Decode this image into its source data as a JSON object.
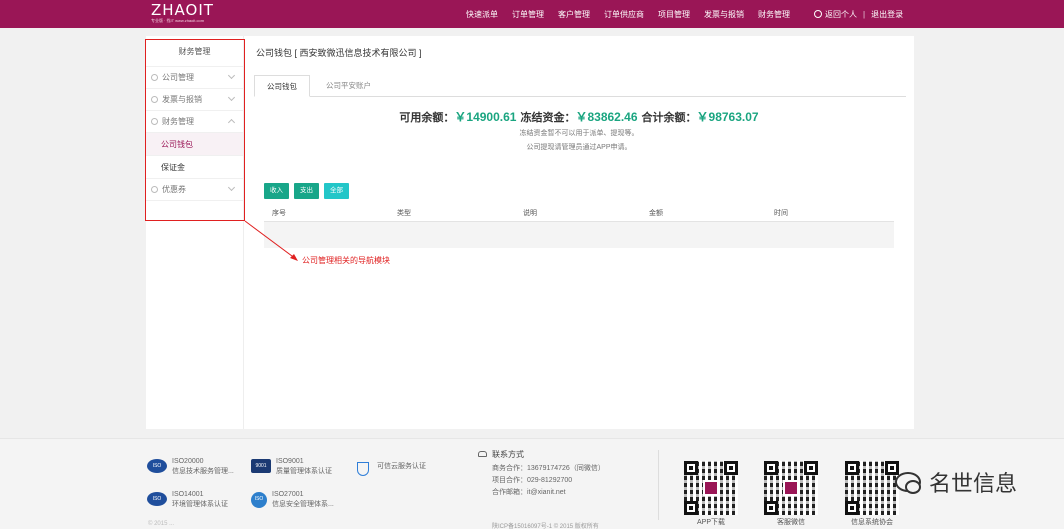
{
  "header": {
    "logo": "ZHAOIT",
    "logo_tag": "专业版 · 找IT  www.zhaoit.com",
    "nav": [
      "快速派单",
      "订单管理",
      "客户管理",
      "订单供应商",
      "项目管理",
      "发票与报销",
      "财务管理"
    ],
    "user_label": "返回个人",
    "separator": "|",
    "logout": "退出登录"
  },
  "sidebar": {
    "title": "财务管理",
    "items": [
      {
        "label": "公司管理",
        "expanded": false
      },
      {
        "label": "发票与报销",
        "expanded": false
      },
      {
        "label": "财务管理",
        "expanded": true
      },
      {
        "label": "公司钱包",
        "sub": true,
        "active": true
      },
      {
        "label": "保证金",
        "sub": true
      },
      {
        "label": "优惠券",
        "expanded": false
      }
    ]
  },
  "main": {
    "title": "公司钱包 [ 西安致微迅信息技术有限公司 ]",
    "tabs": [
      "公司钱包",
      "公司平安账户"
    ],
    "balance": {
      "available_label": "可用余额：",
      "available_value": "￥14900.61",
      "frozen_label": "冻结资金：",
      "frozen_value": "￥83862.46",
      "total_label": "合计余额：",
      "total_value": "￥98763.07"
    },
    "note_1": "冻结资金暂不可以用于派单、提现等。",
    "note_2": "公司提现请管理员通过APP申请。",
    "filters": [
      "收入",
      "支出",
      "全部"
    ],
    "columns": [
      "序号",
      "类型",
      "说明",
      "金额",
      "时间"
    ]
  },
  "annotation": "公司管理相关的导航模块",
  "footer": {
    "certs": [
      {
        "badge": "ISO",
        "title": "ISO20000",
        "desc": "信息技术服务管理..."
      },
      {
        "badge": "9001",
        "title": "ISO9001",
        "desc": "质量管理体系认证"
      },
      {
        "badge": "",
        "title": "可信云服务认证",
        "desc": ""
      },
      {
        "badge": "ISO",
        "title": "ISO14001",
        "desc": "环境管理体系认证"
      },
      {
        "badge": "ISO",
        "title": "ISO27001",
        "desc": "信息安全管理体系..."
      }
    ],
    "contact_title": "联系方式",
    "contact_lines": [
      "商务合作：13679174726（同微信）",
      "项目合作：029-81292700",
      "合作邮箱：it@xianit.net"
    ],
    "icp": "陕ICP备15016097号-1 © 2015 版权所有",
    "left_cut": "© 2015 ...",
    "qr_labels": [
      "APP下载",
      "客服微信",
      "信息系统协会"
    ],
    "watermark": "名世信息"
  },
  "colors": {
    "brand": "#9a1656",
    "amount": "#1aa580",
    "annotation": "#e02020",
    "btn_green": "#18a689",
    "btn_cyan": "#23c6c8"
  }
}
